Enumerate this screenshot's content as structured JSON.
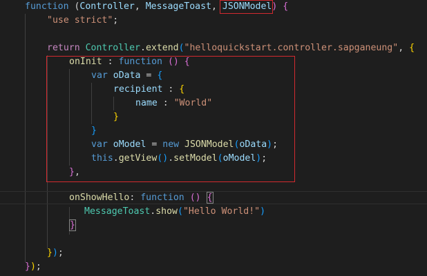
{
  "editor": {
    "theme": "dark",
    "colors": {
      "background": "#1e1e1e",
      "keyword": "#569cd6",
      "control": "#c586c0",
      "function": "#dcdcaa",
      "string": "#ce9178",
      "class": "#4ec9b0",
      "variable": "#9cdcfe",
      "bracket_gold": "#ffd700",
      "bracket_orchid": "#da70d6",
      "bracket_blue": "#179fff",
      "annotation_red": "#d42a2f"
    }
  },
  "code": {
    "l1": {
      "function_kw": "function",
      "p1": " (",
      "arg_controller": "Controller",
      "comma1": ", ",
      "arg_messagetoast": "MessageToast",
      "comma2": ", ",
      "arg_jsonmodel": "JSONModel",
      "close_paren": ")",
      "sp": " ",
      "open_brace": "{"
    },
    "l2": {
      "use_strict": "\"use strict\"",
      "semi": ";"
    },
    "l4": {
      "return_kw": "return",
      "sp": " ",
      "controller": "Controller",
      "dot": ".",
      "extend": "extend",
      "open_paren": "(",
      "name_str": "\"helloquickstart.controller.sapganeung\"",
      "comma": ", ",
      "open_brace": "{"
    },
    "l5": {
      "oninit": "onInit",
      "colon": " : ",
      "function_kw": "function",
      "sp": " ",
      "parens": "()",
      "sp2": " ",
      "open_brace": "{"
    },
    "l6": {
      "var_kw": "var",
      "sp": " ",
      "odata": "oData",
      "eq": " = ",
      "open_brace": "{"
    },
    "l7": {
      "recipient": "recipient",
      "colon": " : ",
      "open_brace": "{"
    },
    "l8": {
      "name_key": "name",
      "colon": " : ",
      "world_str": "\"World\""
    },
    "l9": {
      "close_brace": "}"
    },
    "l10": {
      "close_brace": "}"
    },
    "l11": {
      "var_kw": "var",
      "sp": " ",
      "omodel": "oModel",
      "eq": " = ",
      "new_kw": "new",
      "sp2": " ",
      "jsonmodel": "JSONModel",
      "open_paren": "(",
      "odata": "oData",
      "close_paren": ")",
      "semi": ";"
    },
    "l12": {
      "this_kw": "this",
      "dot1": ".",
      "getview": "getView",
      "parens": "()",
      "dot2": ".",
      "setmodel": "setModel",
      "open_paren": "(",
      "omodel": "oModel",
      "close_paren": ")",
      "semi": ";"
    },
    "l13": {
      "close_brace": "}",
      "comma": ","
    },
    "l15": {
      "onshowhello": "onShowHello",
      "colon": ": ",
      "function_kw": "function",
      "sp": " ",
      "parens": "()",
      "sp2": " ",
      "open_brace": "{"
    },
    "l16": {
      "messagetoast": "MessageToast",
      "dot": ".",
      "show": "show",
      "open_paren": "(",
      "hello_str": "\"Hello World!\"",
      "close_paren": ")"
    },
    "l17": {
      "close_brace": "}"
    },
    "l19": {
      "close_brace": "}",
      "close_paren": ")",
      "semi": ";"
    },
    "l20": {
      "close_brace": "}",
      "close_paren": ")",
      "semi": ";"
    }
  }
}
